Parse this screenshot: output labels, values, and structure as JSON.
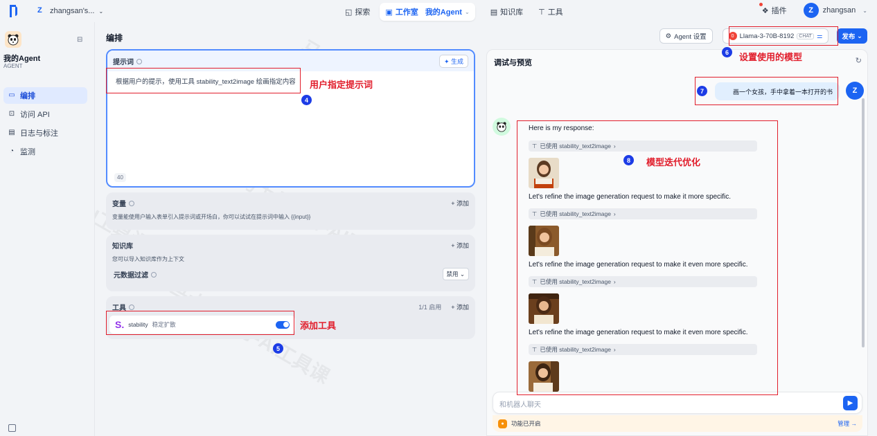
{
  "topnav": {
    "workspace": "zhangsan's...",
    "workspace_initial": "Z",
    "explore": "探索",
    "studio": "工作室",
    "agent": "我的Agent",
    "knowledge": "知识库",
    "tools": "工具",
    "plugins": "插件",
    "user_initial": "Z",
    "username": "zhangsan"
  },
  "sidebar": {
    "app_name": "我的Agent",
    "app_type": "AGENT",
    "items": [
      {
        "label": "编排",
        "icon": "layout-icon"
      },
      {
        "label": "访问 API",
        "icon": "terminal-icon"
      },
      {
        "label": "日志与标注",
        "icon": "document-icon"
      },
      {
        "label": "监测",
        "icon": "gauge-icon"
      }
    ]
  },
  "editor": {
    "title": "编排",
    "prompt_label": "提示词",
    "generate": "生成",
    "prompt_text": "根据用户的提示，使用工具 stability_text2image 绘画指定内容",
    "prompt_count": "40",
    "variables_label": "变量",
    "variables_add": "+ 添加",
    "variables_desc": "变量能使用户输入表单引入提示词或开场白，你可以试试在提示词中输入 {{input}}",
    "knowledge_label": "知识库",
    "knowledge_add": "+ 添加",
    "knowledge_desc": "您可以导入知识库作为上下文",
    "metadata_label": "元数据过滤",
    "metadata_btn": "禁用",
    "tools_label": "工具",
    "tools_enabled": "1/1 启用",
    "tools_add": "+ 添加",
    "tool_name": "stability",
    "tool_desc": "稳定扩散"
  },
  "actions": {
    "agent_settings": "Agent 设置",
    "model_badge": "0",
    "model": "Llama-3-70B-8192",
    "model_tag": "CHAT",
    "publish": "发布"
  },
  "preview": {
    "title": "调试与预览",
    "user_message": "画一个女孩，手中拿着一本打开的书",
    "user_initial": "Z",
    "responses": [
      "Here is my response:",
      "Let's refine the image generation request to make it more specific.",
      "Let's refine the image generation request to make it even more specific.",
      "Let's refine the image generation request to make it even more specific."
    ],
    "tool_used": "已使用 stability_text2image",
    "input_placeholder": "和机器人聊天",
    "feature_status": "功能已开启",
    "manage": "管理 →"
  },
  "annotations": {
    "a4": "用户指定提示词",
    "a5": "添加工具",
    "a6": "设置使用的模型",
    "a8": "模型迭代优化",
    "n4": "4",
    "n5": "5",
    "n6": "6",
    "n7": "7",
    "n8": "8"
  },
  "watermark": "马士兵教育-AI工具课",
  "colors": {
    "accent": "#1c64f2",
    "annotation": "#e11d2b",
    "badge": "#1c3ce6"
  }
}
